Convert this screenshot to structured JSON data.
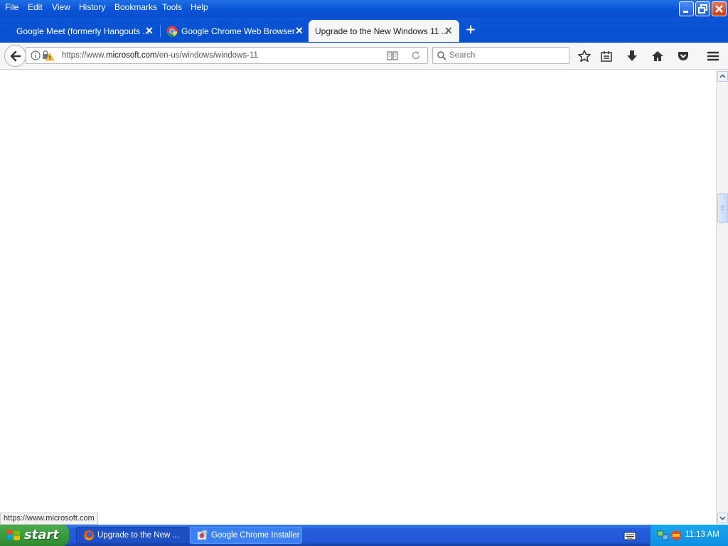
{
  "menu": {
    "items": [
      {
        "label": "File"
      },
      {
        "label": "Edit"
      },
      {
        "label": "View"
      },
      {
        "label": "History"
      },
      {
        "label": "Bookmarks"
      },
      {
        "label": "Tools"
      },
      {
        "label": "Help"
      }
    ]
  },
  "window_controls": {
    "minimize_icon": "minimize-icon",
    "restore_icon": "restore-icon",
    "close_icon": "close-icon"
  },
  "tabs": [
    {
      "label": "Google Meet (formerly Hangouts ...",
      "active": false
    },
    {
      "label": "Google Chrome Web Browser",
      "active": false,
      "icon": "chrome-icon"
    },
    {
      "label": "Upgrade to the New Windows 11 ...",
      "active": true
    }
  ],
  "toolbar": {
    "url_prefix": "https://www.",
    "url_domain": "microsoft.com",
    "url_path": "/en-us/windows/windows-11",
    "search_placeholder": "Search"
  },
  "status_bar": {
    "text": "https://www.microsoft.com"
  },
  "taskbar": {
    "start_label": "start",
    "tasks": [
      {
        "label": "Upgrade to the New ..."
      },
      {
        "label": "Google Chrome Installer"
      }
    ],
    "clock": "11:13 AM"
  },
  "colors": {
    "titlebar": "#0a54d8",
    "taskbar": "#245edb",
    "start": "#3a9c3a",
    "tray": "#0f8fe0"
  }
}
